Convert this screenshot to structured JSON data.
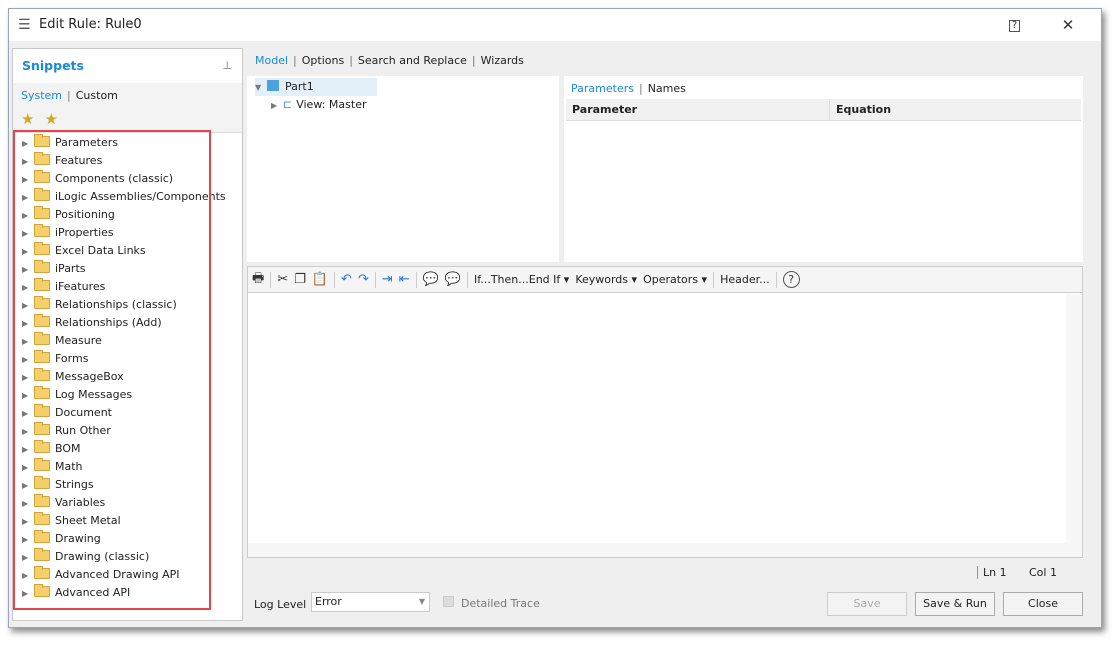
{
  "window": {
    "title": "Edit Rule: Rule0",
    "help": "?",
    "close": "✕"
  },
  "snippets": {
    "title": "Snippets",
    "pin": "⊥",
    "tabs": [
      "System",
      "Custom"
    ],
    "items": [
      "Parameters",
      "Features",
      "Components (classic)",
      "iLogic Assemblies/Components",
      "Positioning",
      "iProperties",
      "Excel Data Links",
      "iParts",
      "iFeatures",
      "Relationships (classic)",
      "Relationships (Add)",
      "Measure",
      "Forms",
      "MessageBox",
      "Log Messages",
      "Document",
      "Run Other",
      "BOM",
      "Math",
      "Strings",
      "Variables",
      "Sheet Metal",
      "Drawing",
      "Drawing (classic)",
      "Advanced Drawing API",
      "Advanced API"
    ]
  },
  "top_tabs": [
    "Model",
    "Options",
    "Search and Replace",
    "Wizards"
  ],
  "model_tree": {
    "root": "Part1",
    "child": "View: Master"
  },
  "params": {
    "tabs": [
      "Parameters",
      "Names"
    ],
    "columns": [
      "Parameter",
      "Equation"
    ]
  },
  "toolbar": {
    "if_then": "If...Then...End If",
    "keywords": "Keywords",
    "operators": "Operators",
    "header": "Header..."
  },
  "status": {
    "ln": "Ln 1",
    "col": "Col 1"
  },
  "bottom": {
    "log_level_label": "Log Level",
    "log_level_value": "Error",
    "detailed_trace": "Detailed Trace",
    "save": "Save",
    "save_run": "Save & Run",
    "close": "Close"
  },
  "colors": {
    "accent": "#1a8ad4",
    "highlight": "#e8454a"
  }
}
